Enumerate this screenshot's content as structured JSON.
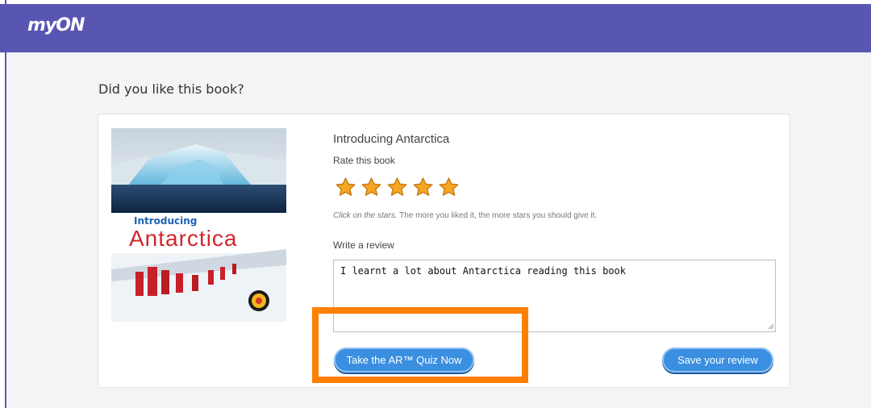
{
  "header": {
    "logo_text": "myON"
  },
  "page": {
    "question": "Did you like this book?"
  },
  "book": {
    "cover_small": "Introducing",
    "cover_big": "Antarctica",
    "title": "Introducing Antarctica"
  },
  "rating": {
    "label": "Rate this book",
    "value": 5,
    "max": 5,
    "hint_italic": "Click on the stars.",
    "hint_rest": " The more you liked it, the more stars you should give it."
  },
  "review": {
    "label": "Write a review",
    "text": "I learnt a lot about Antarctica reading this book"
  },
  "buttons": {
    "quiz_label": "Take the AR™ Quiz Now",
    "save_label": "Save your review"
  },
  "colors": {
    "header": "#5956b3",
    "button": "#3b8fe0",
    "star": "#f5a623",
    "highlight": "#ff7f00"
  }
}
